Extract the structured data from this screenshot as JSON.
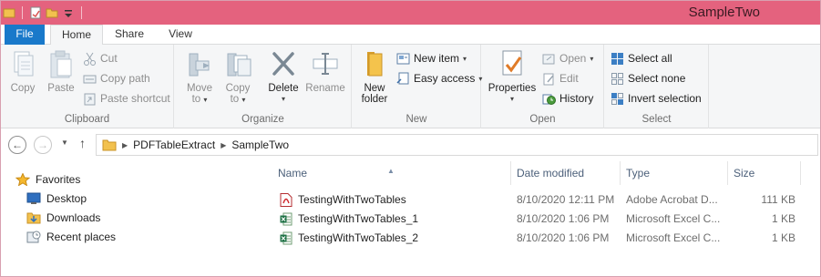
{
  "window": {
    "title": "SampleTwo"
  },
  "tabs": [
    {
      "label": "File"
    },
    {
      "label": "Home"
    },
    {
      "label": "Share"
    },
    {
      "label": "View"
    }
  ],
  "ribbon": {
    "clipboard": {
      "label": "Clipboard",
      "copy": "Copy",
      "paste": "Paste",
      "cut": "Cut",
      "copy_path": "Copy path",
      "paste_shortcut": "Paste shortcut"
    },
    "organize": {
      "label": "Organize",
      "move_to_line1": "Move",
      "move_to_line2": "to",
      "copy_to_line1": "Copy",
      "copy_to_line2": "to",
      "delete": "Delete",
      "rename": "Rename"
    },
    "new": {
      "label": "New",
      "new_folder_line1": "New",
      "new_folder_line2": "folder",
      "new_item": "New item",
      "easy_access": "Easy access"
    },
    "open": {
      "label": "Open",
      "properties": "Properties",
      "open": "Open",
      "edit": "Edit",
      "history": "History"
    },
    "select": {
      "label": "Select",
      "select_all": "Select all",
      "select_none": "Select none",
      "invert_selection": "Invert selection"
    }
  },
  "address": {
    "crumbs": [
      "PDFTableExtract",
      "SampleTwo"
    ]
  },
  "navpane": {
    "favorites": "Favorites",
    "items": [
      "Desktop",
      "Downloads",
      "Recent places"
    ]
  },
  "filelist": {
    "columns": {
      "name": "Name",
      "date_modified": "Date modified",
      "type": "Type",
      "size": "Size"
    },
    "rows": [
      {
        "name": "TestingWithTwoTables",
        "date": "8/10/2020 12:11 PM",
        "type": "Adobe Acrobat D...",
        "size": "111 KB",
        "icon": "pdf-file-icon"
      },
      {
        "name": "TestingWithTwoTables_1",
        "date": "8/10/2020 1:06 PM",
        "type": "Microsoft Excel C...",
        "size": "1 KB",
        "icon": "excel-csv-file-icon"
      },
      {
        "name": "TestingWithTwoTables_2",
        "date": "8/10/2020 1:06 PM",
        "type": "Microsoft Excel C...",
        "size": "1 KB",
        "icon": "excel-csv-file-icon"
      }
    ]
  },
  "colors": {
    "titlebar": "#e4627e",
    "file_tab": "#1979ca",
    "column_header_text": "#4c607a"
  }
}
